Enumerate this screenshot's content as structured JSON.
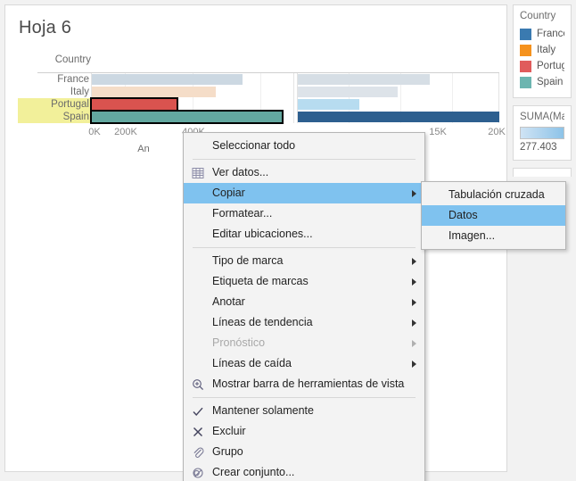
{
  "sheet": {
    "title": "Hoja 6",
    "field_header": "Country",
    "axis_title": "An"
  },
  "chart_data": {
    "type": "bar",
    "title": "Hoja 6",
    "xlabel": "An",
    "ylabel": "Country",
    "categories": [
      "France",
      "Italy",
      "Portugal",
      "Spain"
    ],
    "highlighted": [
      "Portugal",
      "Spain"
    ],
    "panes": [
      {
        "name": "pane-1",
        "ticks": [
          "0K",
          "200K",
          "400K"
        ],
        "tick_values": [
          0,
          200000,
          400000
        ],
        "xlim": [
          0,
          600000
        ],
        "values": [
          445000,
          365000,
          250000,
          560000
        ],
        "colors": [
          "#ccd8e2",
          "#f5ddc8",
          "#d9534f",
          "#63a8a0"
        ]
      },
      {
        "name": "pane-2",
        "ticks": [
          "15K",
          "20K"
        ],
        "tick_values": [
          15000,
          20000
        ],
        "xlim": [
          0,
          23000
        ],
        "values": [
          14800,
          11200,
          6900,
          23000
        ],
        "colors": [
          "#d6dee5",
          "#dde3e9",
          "#b7dcf0",
          "#2d5f8f"
        ]
      }
    ],
    "grid": true,
    "legend_position": "right"
  },
  "legend": {
    "country": {
      "title": "Country",
      "items": [
        {
          "label": "France",
          "color": "#3a7ab0"
        },
        {
          "label": "Italy",
          "color": "#f5921e"
        },
        {
          "label": "Portugal",
          "color": "#e05c5c"
        },
        {
          "label": "Spain",
          "color": "#6cb5b0"
        }
      ]
    },
    "measure": {
      "title": "SUMA(Ma",
      "min_label": "277.403",
      "gradient_from": "#cfe3f4",
      "gradient_to": "#8dc3e8"
    }
  },
  "context_menu": {
    "items": [
      {
        "label": "Seleccionar todo",
        "icon": "",
        "arrow": false,
        "highlighted": false,
        "disabled": false
      },
      {
        "separator": true
      },
      {
        "label": "Ver datos...",
        "icon": "grid-icon",
        "arrow": false,
        "highlighted": false,
        "disabled": false
      },
      {
        "label": "Copiar",
        "icon": "",
        "arrow": true,
        "highlighted": true,
        "disabled": false
      },
      {
        "label": "Formatear...",
        "icon": "",
        "arrow": false,
        "highlighted": false,
        "disabled": false
      },
      {
        "label": "Editar ubicaciones...",
        "icon": "",
        "arrow": false,
        "highlighted": false,
        "disabled": false
      },
      {
        "separator": true
      },
      {
        "label": "Tipo de marca",
        "icon": "",
        "arrow": true,
        "highlighted": false,
        "disabled": false
      },
      {
        "label": "Etiqueta de marcas",
        "icon": "",
        "arrow": true,
        "highlighted": false,
        "disabled": false
      },
      {
        "label": "Anotar",
        "icon": "",
        "arrow": true,
        "highlighted": false,
        "disabled": false
      },
      {
        "label": "Líneas de tendencia",
        "icon": "",
        "arrow": true,
        "highlighted": false,
        "disabled": false
      },
      {
        "label": "Pronóstico",
        "icon": "",
        "arrow": true,
        "highlighted": false,
        "disabled": true
      },
      {
        "label": "Líneas de caída",
        "icon": "",
        "arrow": true,
        "highlighted": false,
        "disabled": false
      },
      {
        "label": "Mostrar barra de herramientas de vista",
        "icon": "zoom-in-icon",
        "arrow": false,
        "highlighted": false,
        "disabled": false
      },
      {
        "separator": true
      },
      {
        "label": "Mantener solamente",
        "icon": "check-icon",
        "arrow": false,
        "highlighted": false,
        "disabled": false
      },
      {
        "label": "Excluir",
        "icon": "close-icon",
        "arrow": false,
        "highlighted": false,
        "disabled": false
      },
      {
        "label": "Grupo",
        "icon": "paperclip-icon",
        "arrow": false,
        "highlighted": false,
        "disabled": false
      },
      {
        "label": "Crear conjunto...",
        "icon": "set-icon",
        "arrow": false,
        "highlighted": false,
        "disabled": false
      }
    ],
    "submenu": {
      "items": [
        {
          "label": "Tabulación cruzada",
          "highlighted": false
        },
        {
          "label": "Datos",
          "highlighted": true
        },
        {
          "label": "Imagen...",
          "highlighted": false
        }
      ]
    }
  },
  "colors": {
    "highlight_row": "#f2f09a",
    "menu_highlight": "#7fc2ef",
    "selection_border": "#000000"
  }
}
